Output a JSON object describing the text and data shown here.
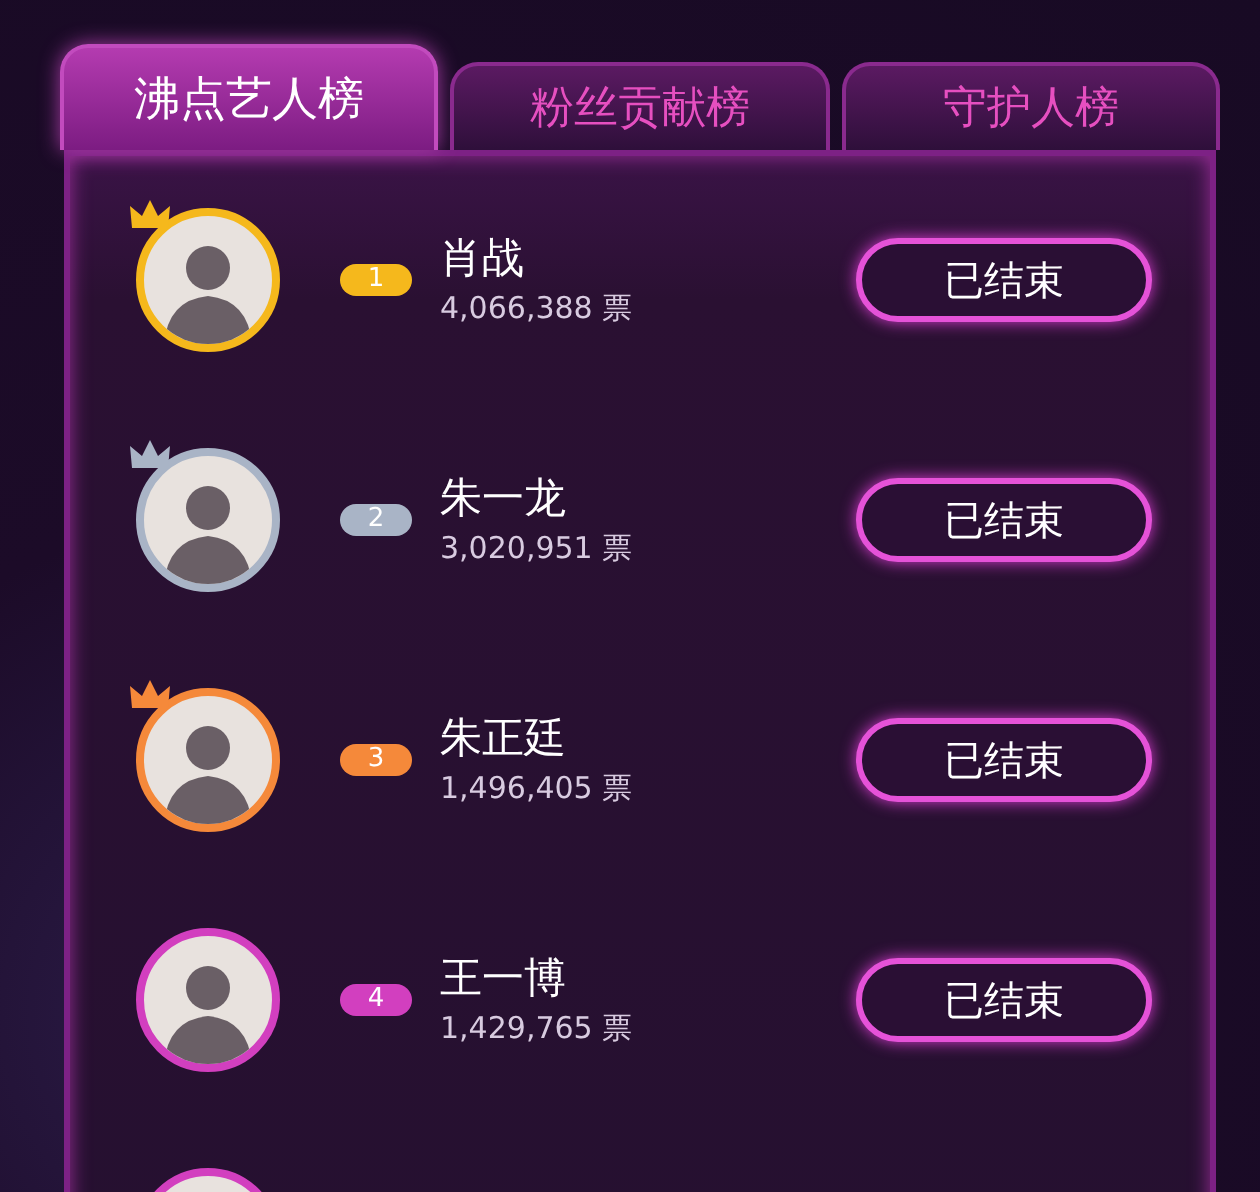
{
  "tabs": [
    {
      "label": "沸点艺人榜",
      "selected": true
    },
    {
      "label": "粉丝贡献榜",
      "selected": false
    },
    {
      "label": "守护人榜",
      "selected": false
    }
  ],
  "rows": [
    {
      "kind": "full",
      "rank": "1",
      "color": "#f5b81c",
      "crown": true,
      "name": "肖战",
      "votes": "4,066,388 票",
      "button": "已结束"
    },
    {
      "kind": "full",
      "rank": "2",
      "color": "#a9b4c6",
      "crown": true,
      "name": "朱一龙",
      "votes": "3,020,951 票",
      "button": "已结束"
    },
    {
      "kind": "full",
      "rank": "3",
      "color": "#f5893a",
      "crown": true,
      "name": "朱正廷",
      "votes": "1,496,405 票",
      "button": "已结束"
    },
    {
      "kind": "full",
      "rank": "4",
      "color": "#d23fbf",
      "crown": false,
      "name": "王一博",
      "votes": "1,429,765 票",
      "button": "已结束"
    },
    {
      "kind": "cut",
      "color": "#d23fbf",
      "crown": false
    }
  ]
}
